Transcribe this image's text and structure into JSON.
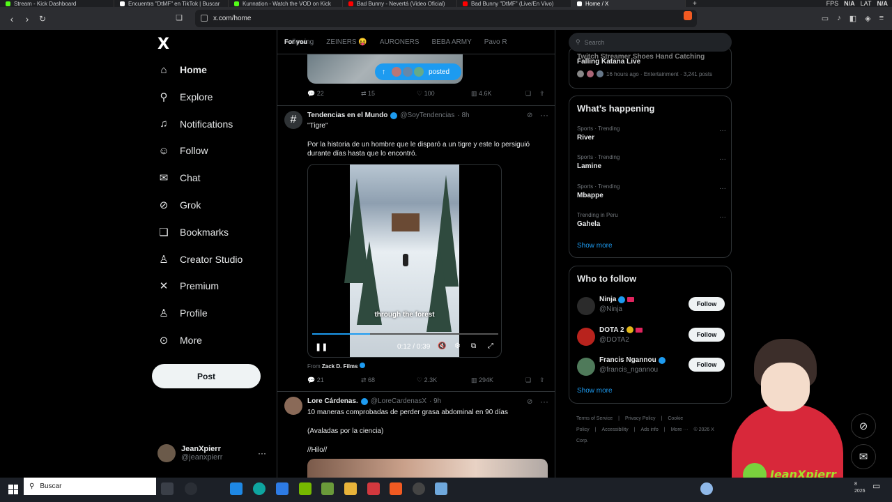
{
  "browser": {
    "tabs": [
      {
        "title": "Stream - Kick Dashboard",
        "color": "#53fc18",
        "active": false
      },
      {
        "title": "Encuentra \"DtMF\" en TikTok | Buscar",
        "color": "#ffffff",
        "active": false
      },
      {
        "title": "Kunnation - Watch the VOD on Kick",
        "color": "#53fc18",
        "active": false
      },
      {
        "title": "Bad Bunny - Nevertá (Video Oficial)",
        "color": "#ff0000",
        "active": false
      },
      {
        "title": "Bad Bunny \"DtMF\" (Live/En Vivo)",
        "color": "#ff0000",
        "active": false
      },
      {
        "title": "Home / X",
        "color": "#ffffff",
        "active": true
      }
    ],
    "fps_label": "FPS",
    "fps_value": "N/A",
    "lat_label": "LAT",
    "lat_value": "N/A",
    "url": "x.com/home"
  },
  "sidebar": {
    "logo": "X",
    "items": [
      {
        "label": "Home",
        "icon": "home-icon",
        "glyph": "⌂"
      },
      {
        "label": "Explore",
        "icon": "search-icon",
        "glyph": "⚲"
      },
      {
        "label": "Notifications",
        "icon": "bell-icon",
        "glyph": "♫"
      },
      {
        "label": "Follow",
        "icon": "follow-icon",
        "glyph": "☺"
      },
      {
        "label": "Chat",
        "icon": "mail-icon",
        "glyph": "✉"
      },
      {
        "label": "Grok",
        "icon": "grok-icon",
        "glyph": "⊘"
      },
      {
        "label": "Bookmarks",
        "icon": "bookmark-icon",
        "glyph": "❏"
      },
      {
        "label": "Creator Studio",
        "icon": "creator-studio-icon",
        "glyph": "♙"
      },
      {
        "label": "Premium",
        "icon": "x-premium-icon",
        "glyph": "✕"
      },
      {
        "label": "Profile",
        "icon": "profile-icon",
        "glyph": "♙"
      },
      {
        "label": "More",
        "icon": "more-circle-icon",
        "glyph": "⊙"
      }
    ],
    "post_label": "Post",
    "user_name": "JeanXpierr",
    "user_handle": "@jeanxpierr"
  },
  "feed": {
    "tabs": [
      "For you",
      "Following",
      "ZEINERS 😝",
      "AURONERS",
      "BEBA ARMY",
      "Pavo R"
    ],
    "posted_label": "posted",
    "top_actions": {
      "replies": "22",
      "reposts": "15",
      "likes": "100",
      "views": "4.6K"
    },
    "tweet1": {
      "name": "Tendencias en el Mundo",
      "handle": "@SoyTendencias",
      "time": "· 8h",
      "title": "\"Tigre\"",
      "body": "Por la historia de un hombre que le disparó a un tigre y este lo persiguió durante días hasta que lo encontró.",
      "caption": "through the forest",
      "video_time": "0:12 / 0:39",
      "video_progress": 0.31,
      "from_label": "From",
      "from_name": "Zack D. Films",
      "actions": {
        "replies": "21",
        "reposts": "68",
        "likes": "2.3K",
        "views": "294K"
      }
    },
    "tweet2": {
      "name": "Lore Cárdenas.",
      "handle": "@LoreCardenasX",
      "time": "· 9h",
      "line1": "10 maneras comprobadas de perder grasa abdominal en 90 días",
      "line2": "(Avaladas por la ciencia)",
      "line3": "//Hilo//"
    }
  },
  "right": {
    "search_placeholder": "Search",
    "top_trend_title1": "Twitch Streamer Shoes Hand Catching",
    "top_trend_title2": "Falling Katana Live",
    "top_trend_meta": "16 hours ago · Entertainment · 3,241 posts",
    "happening_title": "What’s happening",
    "trends": [
      {
        "context": "Sports · Trending",
        "name": "River"
      },
      {
        "context": "Sports · Trending",
        "name": "Lamine"
      },
      {
        "context": "Sports · Trending",
        "name": "Mbappe"
      },
      {
        "context": "Trending in Peru",
        "name": "Gahela"
      }
    ],
    "show_more": "Show more",
    "wtf_title": "Who to follow",
    "wtf": [
      {
        "name": "Ninja",
        "handle": "@Ninja",
        "avatar_color": "#2b2b2b"
      },
      {
        "name": "DOTA 2",
        "handle": "@DOTA2",
        "avatar_color": "#b8231d"
      },
      {
        "name": "Francis Ngannou",
        "handle": "@francis_ngannou",
        "avatar_color": "#4f7a5a"
      }
    ],
    "follow_label": "Follow",
    "footer": [
      "Terms of Service",
      "|",
      "Privacy Policy",
      "|",
      "Cookie Policy",
      "|",
      "Accessibility",
      "|",
      "Ads info",
      "|",
      "More ···",
      "© 2026 X Corp."
    ]
  },
  "overlay": {
    "streamer_name": "JeanXpierr"
  },
  "taskbar": {
    "search_placeholder": "Buscar",
    "date_line1": "8",
    "date_line2": "2026"
  }
}
